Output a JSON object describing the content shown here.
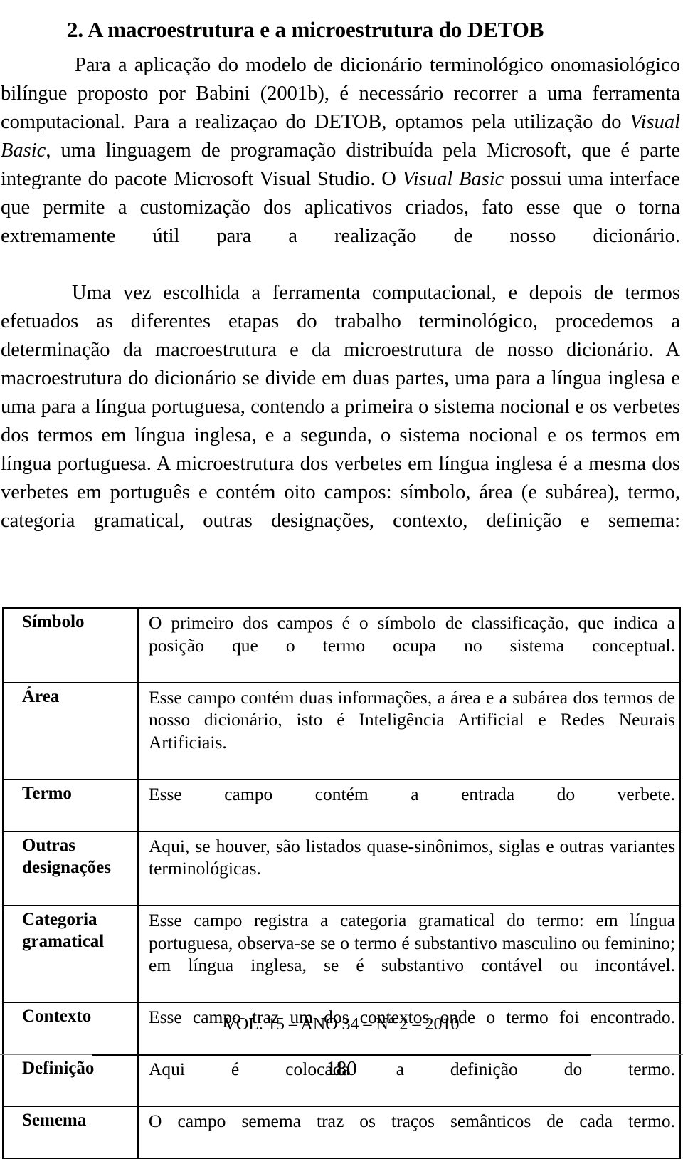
{
  "heading": {
    "number": "2.",
    "text": "2. A macroestrutura e a microestrutura do DETOB"
  },
  "paragraphs": {
    "p1_part1": "Para a aplicação do modelo de dicionário terminológico onomasiológico bilíngue proposto por Babini (2001b), é necessário recorrer a uma ferramenta computacional. Para a realizaçao do DETOB, optamos pela utilização do ",
    "p1_italic1": "Visual Basic",
    "p1_part2": ", uma linguagem de programação distribuída pela Microsoft, que é parte integrante do pacote Microsoft Visual Studio. O ",
    "p1_italic2": "Visual Basic",
    "p1_part3": " possui uma interface que permite a customização dos aplicativos criados, fato esse que o torna extremamente útil para a realização de nosso dicionário.",
    "p2": "Uma vez escolhida a ferramenta computacional, e depois de termos efetuados as diferentes etapas do trabalho terminológico, procedemos a determinação da macroestrutura e da microestrutura de nosso dicionário. A macroestrutura do dicionário se divide em duas partes, uma para a língua inglesa e uma para a língua portuguesa, contendo a primeira o sistema nocional e os verbetes dos termos em língua inglesa, e a segunda, o sistema nocional e os termos em língua portuguesa. A microestrutura dos verbetes em língua inglesa é a mesma dos verbetes em português e contém oito campos: símbolo, área (e subárea), termo, categoria gramatical, outras designações, contexto, definição e semema:"
  },
  "fields_table": {
    "rows": [
      {
        "label": "Símbolo",
        "description": "O primeiro dos campos é o símbolo de classificação, que indica a posição que o termo ocupa no sistema conceptual."
      },
      {
        "label": "Área",
        "description": "Esse campo contém duas informações, a área e a subárea dos termos de nosso dicionário, isto é Inteligência Artificial e Redes Neurais Artificiais."
      },
      {
        "label": "Termo",
        "description": "Esse campo contém a entrada do verbete."
      },
      {
        "label": "Outras\ndesignações",
        "description": "Aqui, se houver, são listados quase-sinônimos, siglas e outras variantes terminológicas."
      },
      {
        "label": "Categoria\ngramatical",
        "description": "Esse campo registra a categoria gramatical do termo: em língua portuguesa, observa-se se o termo é substantivo masculino ou feminino; em língua inglesa, se é substantivo contável ou incontável."
      },
      {
        "label": "Contexto",
        "description": "Esse campo traz um dos contextos onde o termo foi encontrado."
      },
      {
        "label": "Definição",
        "description": "Aqui é colocada a definição do termo."
      },
      {
        "label": "Semema",
        "description": "O campo semema traz os traços semânticos de cada termo."
      }
    ]
  },
  "footer": {
    "volume_line": "VOL. 15 – ANO 34 – N° 2 – 2010",
    "page_number": "180"
  }
}
